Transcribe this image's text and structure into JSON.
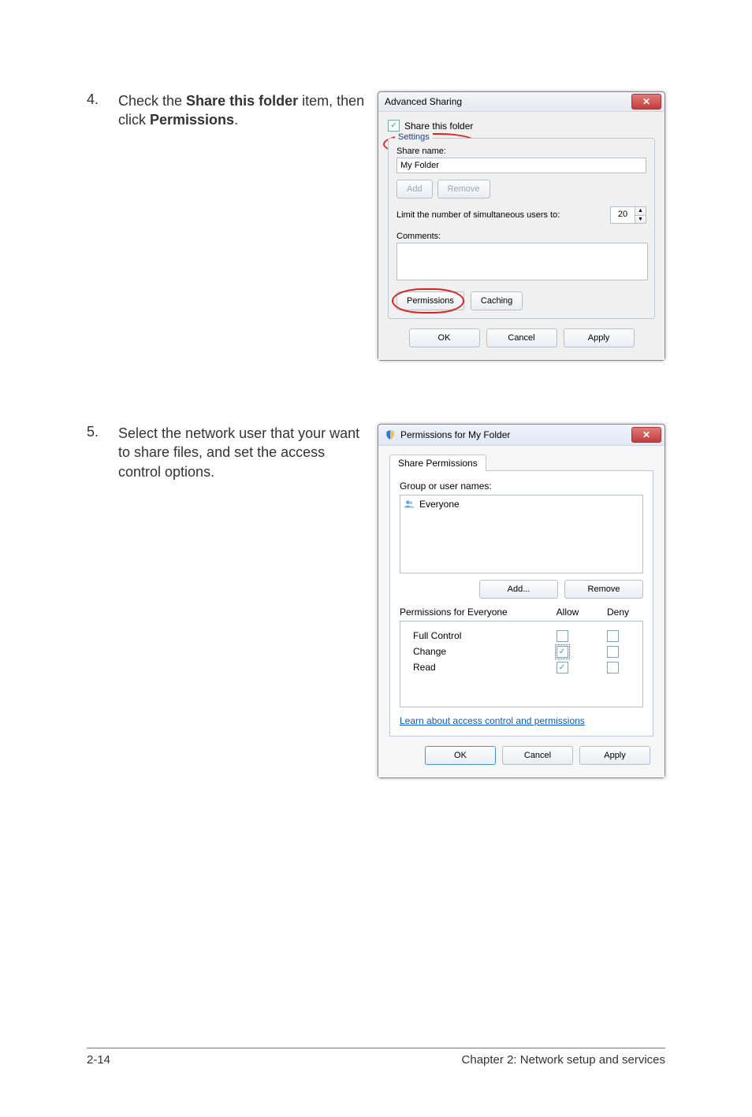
{
  "steps": {
    "s4_num": "4.",
    "s4_text_pre": "Check the ",
    "s4_bold1": "Share this folder",
    "s4_text_mid": " item, then click ",
    "s4_bold2": "Permissions",
    "s4_text_end": ".",
    "s5_num": "5.",
    "s5_text": "Select the network user that your want to share files, and set the access control options."
  },
  "dlg1": {
    "title": "Advanced Sharing",
    "share_checkbox_label": "Share this folder",
    "group_title": "Settings",
    "share_name_label": "Share name:",
    "share_name_value": "My Folder",
    "add_btn": "Add",
    "remove_btn": "Remove",
    "limit_label": "Limit the number of simultaneous users to:",
    "limit_value": "20",
    "comments_label": "Comments:",
    "permissions_btn": "Permissions",
    "caching_btn": "Caching",
    "ok_btn": "OK",
    "cancel_btn": "Cancel",
    "apply_btn": "Apply"
  },
  "dlg2": {
    "title": "Permissions for My Folder",
    "tab_label": "Share Permissions",
    "group_label": "Group or user names:",
    "list_items": [
      "Everyone"
    ],
    "add_btn": "Add...",
    "remove_btn": "Remove",
    "perm_header": "Permissions for Everyone",
    "col_allow": "Allow",
    "col_deny": "Deny",
    "perms": [
      {
        "name": "Full Control",
        "allow": false,
        "deny": false,
        "focus": false
      },
      {
        "name": "Change",
        "allow": true,
        "deny": false,
        "focus": true
      },
      {
        "name": "Read",
        "allow": true,
        "deny": false,
        "focus": false
      }
    ],
    "learn_link": "Learn about access control and permissions",
    "ok_btn": "OK",
    "cancel_btn": "Cancel",
    "apply_btn": "Apply"
  },
  "footer": {
    "left": "2-14",
    "right": "Chapter 2:  Network setup and services"
  }
}
